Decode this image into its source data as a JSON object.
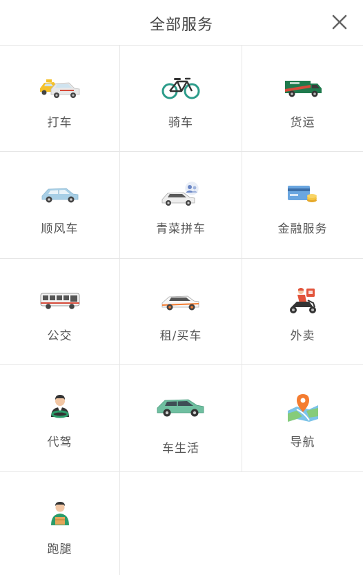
{
  "header": {
    "title": "全部服务",
    "close_icon": "close-icon"
  },
  "colors": {
    "divider": "#e6e6e6",
    "label": "#555555",
    "title": "#444444",
    "accent_orange": "#f47c30",
    "accent_green": "#2c9c6a"
  },
  "services": [
    {
      "label": "打车",
      "icon": "taxi-icon"
    },
    {
      "label": "骑车",
      "icon": "bicycle-icon"
    },
    {
      "label": "货运",
      "icon": "freight-van-icon"
    },
    {
      "label": "顺风车",
      "icon": "car-icon"
    },
    {
      "label": "青菜拼车",
      "icon": "carpool-icon"
    },
    {
      "label": "金融服务",
      "icon": "credit-card-icon"
    },
    {
      "label": "公交",
      "icon": "bus-icon"
    },
    {
      "label": "租/买车",
      "icon": "rent-car-icon"
    },
    {
      "label": "外卖",
      "icon": "delivery-scooter-icon"
    },
    {
      "label": "代驾",
      "icon": "driver-icon"
    },
    {
      "label": "车生活",
      "icon": "suv-icon"
    },
    {
      "label": "导航",
      "icon": "map-pin-icon"
    },
    {
      "label": "跑腿",
      "icon": "courier-icon"
    }
  ]
}
